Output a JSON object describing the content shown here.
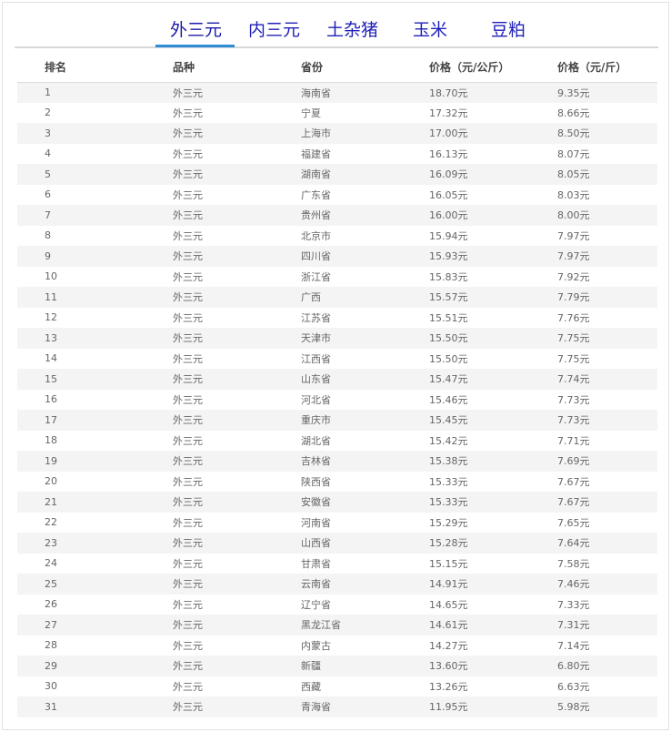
{
  "tabs": [
    {
      "label": "外三元",
      "active": true
    },
    {
      "label": "内三元",
      "active": false
    },
    {
      "label": "土杂猪",
      "active": false
    },
    {
      "label": "玉米",
      "active": false
    },
    {
      "label": "豆粕",
      "active": false
    }
  ],
  "table": {
    "headers": [
      "排名",
      "品种",
      "省份",
      "价格（元/公斤）",
      "价格（元/斤）"
    ],
    "rows": [
      [
        "1",
        "外三元",
        "海南省",
        "18.70元",
        "9.35元"
      ],
      [
        "2",
        "外三元",
        "宁夏",
        "17.32元",
        "8.66元"
      ],
      [
        "3",
        "外三元",
        "上海市",
        "17.00元",
        "8.50元"
      ],
      [
        "4",
        "外三元",
        "福建省",
        "16.13元",
        "8.07元"
      ],
      [
        "5",
        "外三元",
        "湖南省",
        "16.09元",
        "8.05元"
      ],
      [
        "6",
        "外三元",
        "广东省",
        "16.05元",
        "8.03元"
      ],
      [
        "7",
        "外三元",
        "贵州省",
        "16.00元",
        "8.00元"
      ],
      [
        "8",
        "外三元",
        "北京市",
        "15.94元",
        "7.97元"
      ],
      [
        "9",
        "外三元",
        "四川省",
        "15.93元",
        "7.97元"
      ],
      [
        "10",
        "外三元",
        "浙江省",
        "15.83元",
        "7.92元"
      ],
      [
        "11",
        "外三元",
        "广西",
        "15.57元",
        "7.79元"
      ],
      [
        "12",
        "外三元",
        "江苏省",
        "15.51元",
        "7.76元"
      ],
      [
        "13",
        "外三元",
        "天津市",
        "15.50元",
        "7.75元"
      ],
      [
        "14",
        "外三元",
        "江西省",
        "15.50元",
        "7.75元"
      ],
      [
        "15",
        "外三元",
        "山东省",
        "15.47元",
        "7.74元"
      ],
      [
        "16",
        "外三元",
        "河北省",
        "15.46元",
        "7.73元"
      ],
      [
        "17",
        "外三元",
        "重庆市",
        "15.45元",
        "7.73元"
      ],
      [
        "18",
        "外三元",
        "湖北省",
        "15.42元",
        "7.71元"
      ],
      [
        "19",
        "外三元",
        "吉林省",
        "15.38元",
        "7.69元"
      ],
      [
        "20",
        "外三元",
        "陕西省",
        "15.33元",
        "7.67元"
      ],
      [
        "21",
        "外三元",
        "安徽省",
        "15.33元",
        "7.67元"
      ],
      [
        "22",
        "外三元",
        "河南省",
        "15.29元",
        "7.65元"
      ],
      [
        "23",
        "外三元",
        "山西省",
        "15.28元",
        "7.64元"
      ],
      [
        "24",
        "外三元",
        "甘肃省",
        "15.15元",
        "7.58元"
      ],
      [
        "25",
        "外三元",
        "云南省",
        "14.91元",
        "7.46元"
      ],
      [
        "26",
        "外三元",
        "辽宁省",
        "14.65元",
        "7.33元"
      ],
      [
        "27",
        "外三元",
        "黑龙江省",
        "14.61元",
        "7.31元"
      ],
      [
        "28",
        "外三元",
        "内蒙古",
        "14.27元",
        "7.14元"
      ],
      [
        "29",
        "外三元",
        "新疆",
        "13.60元",
        "6.80元"
      ],
      [
        "30",
        "外三元",
        "西藏",
        "13.26元",
        "6.63元"
      ],
      [
        "31",
        "外三元",
        "青海省",
        "11.95元",
        "5.98元"
      ]
    ]
  }
}
